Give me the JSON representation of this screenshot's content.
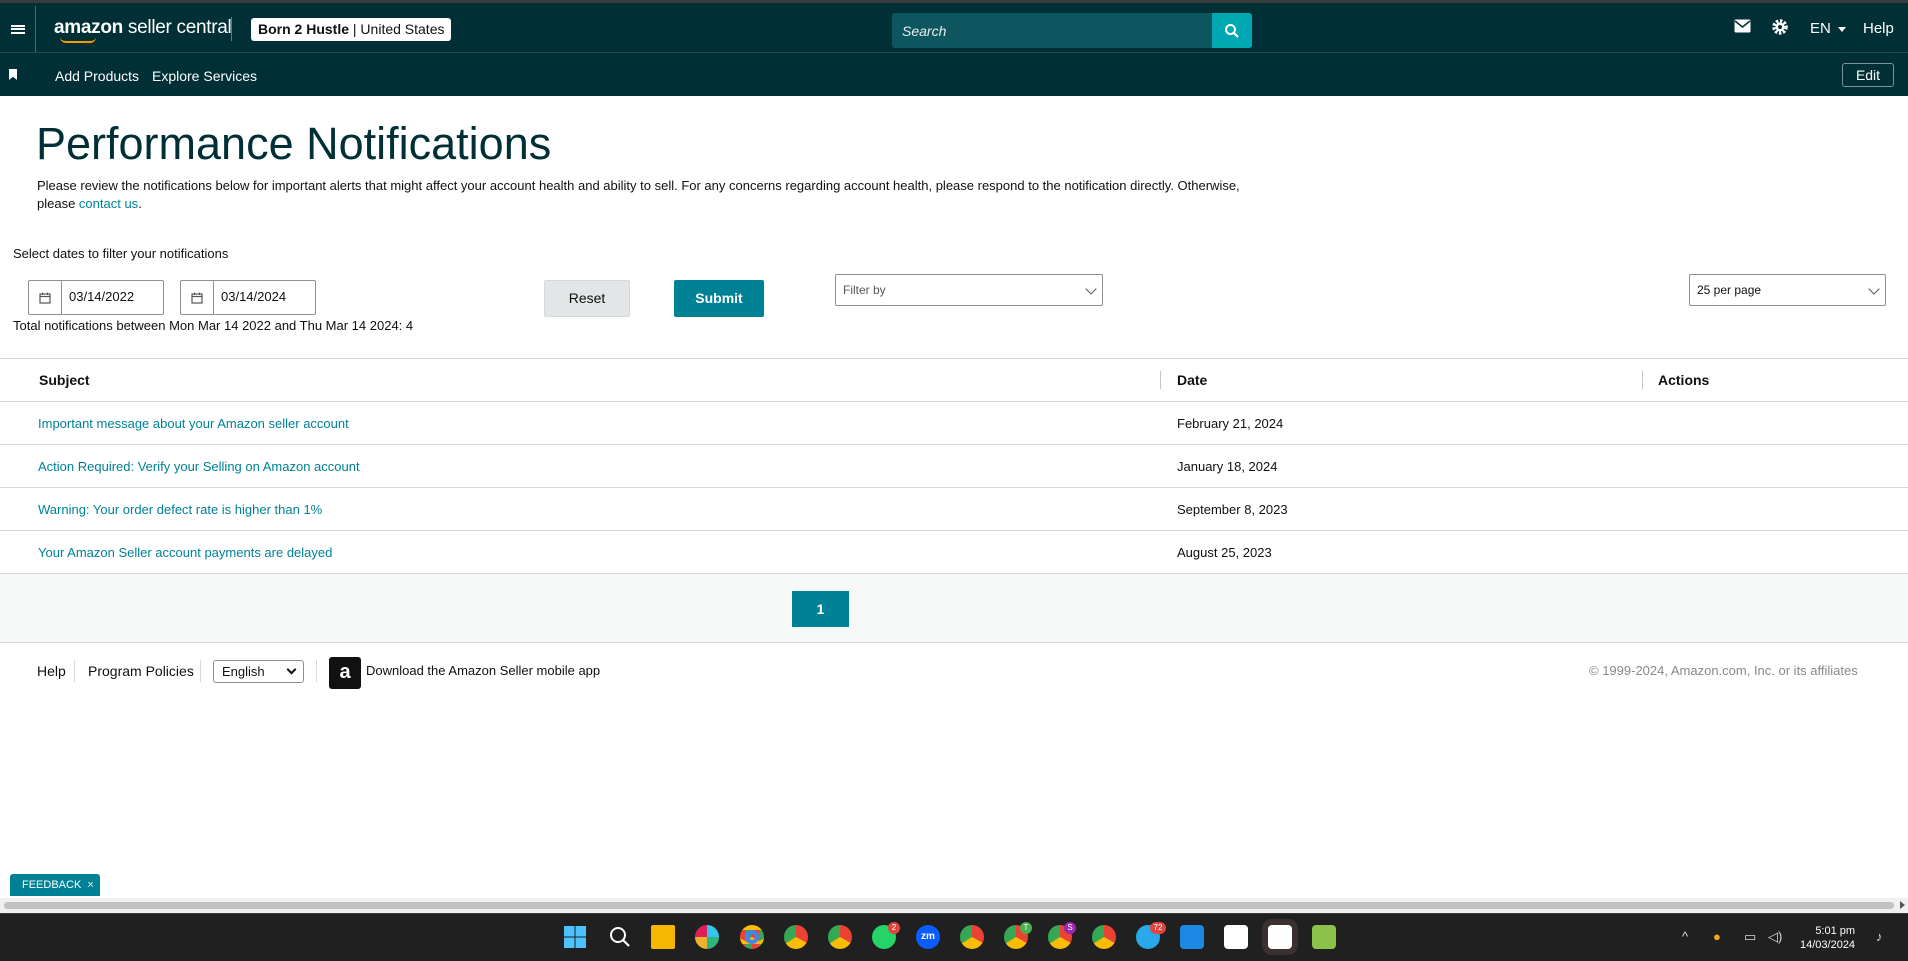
{
  "header": {
    "logo_bold": "amazon",
    "logo_rest": " seller central",
    "account_name": "Born 2 Hustle",
    "account_region": " | United States",
    "search_placeholder": "Search",
    "language": "EN",
    "help": "Help"
  },
  "nav": {
    "items": [
      "Add Products",
      "Explore Services"
    ],
    "edit": "Edit"
  },
  "page": {
    "title": "Performance Notifications",
    "intro": "Please review the notifications below for important alerts that might affect your account health and ability to sell. For any concerns regarding account health, please respond to the notification directly. Otherwise, please ",
    "intro_link": "contact us",
    "intro_end": "."
  },
  "filters": {
    "label": "Select dates to filter your notifications",
    "start_date": "03/14/2022",
    "end_date": "03/14/2024",
    "reset": "Reset",
    "submit": "Submit",
    "filter_by_placeholder": "Filter by",
    "per_page": "25 per page",
    "total": "Total notifications between Mon Mar 14 2022 and Thu Mar 14 2024: 4"
  },
  "table": {
    "headers": [
      "Subject",
      "Date",
      "Actions"
    ],
    "rows": [
      {
        "subject": "Important message about your Amazon seller account",
        "date": "February 21, 2024"
      },
      {
        "subject": "Action Required: Verify your Selling on Amazon account",
        "date": "January 18, 2024"
      },
      {
        "subject": "Warning: Your order defect rate is higher than 1%",
        "date": "September 8, 2023"
      },
      {
        "subject": "Your Amazon Seller account payments are delayed",
        "date": "August 25, 2023"
      }
    ]
  },
  "pagination": {
    "current": "1"
  },
  "footer": {
    "help": "Help",
    "policies": "Program Policies",
    "language": "English",
    "app_icon_glyph": "a",
    "app_text": "Download the Amazon Seller mobile app",
    "copyright": "© 1999-2024, Amazon.com, Inc. or its affiliates"
  },
  "feedback": {
    "label": "FEEDBACK",
    "close": "×"
  },
  "taskbar": {
    "time": "5:01 pm",
    "date": "14/03/2024",
    "badges": {
      "whatsapp": "2",
      "telegram": "72",
      "chrome_t": "T",
      "chrome_s": "S"
    },
    "zoom_label": "zm",
    "icons": [
      "windows-start-icon",
      "search-icon",
      "file-explorer-icon",
      "slack-icon",
      "chrome-icon",
      "chrome-icon",
      "chrome-icon",
      "whatsapp-icon",
      "zoom-icon",
      "chrome-icon",
      "chrome-icon",
      "chrome-icon",
      "chrome-icon",
      "telegram-icon",
      "r-app-icon",
      "capcut-icon",
      "capcut-icon",
      "app-icon"
    ]
  },
  "colors": {
    "header_bg": "#002f36",
    "accent": "#008296",
    "link": "#008296"
  }
}
